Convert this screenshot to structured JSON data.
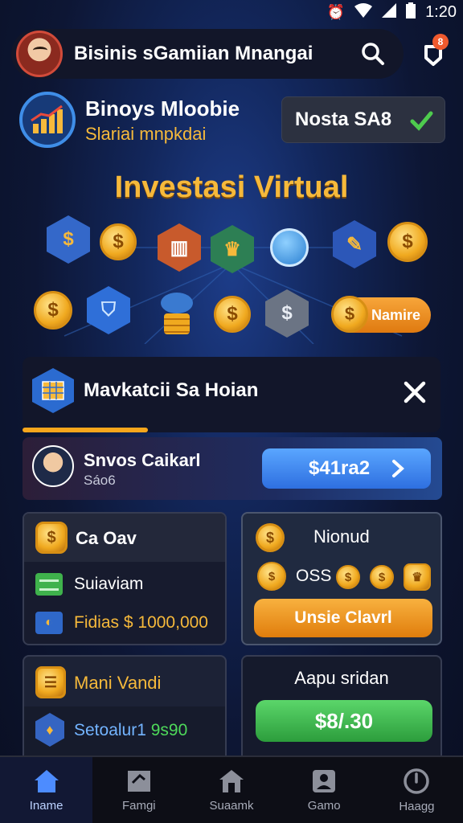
{
  "status_bar": {
    "time": "1:20"
  },
  "header": {
    "title": "Bisinis sGamiian Mnangai",
    "notification_badge": "8"
  },
  "brand": {
    "name": "Binoys Mloobie",
    "subtitle": "Slariai mnpkdai",
    "status_pill": "Nosta SA8"
  },
  "hero": {
    "title": "Investasi Virtual",
    "name_pill": "Namire"
  },
  "section": {
    "title": "Mavkatcii Sa Hoian"
  },
  "user_card": {
    "name": "Snvos Caikarl",
    "sub": "Sáo6",
    "amount": "$41ra2"
  },
  "card_a": {
    "title": "Ca Oav",
    "row1": "Suiaviam",
    "row2_label": "Fidias",
    "row2_value": "$ 1000,000"
  },
  "card_b": {
    "title": "Nionud",
    "row": "OSS",
    "button": "Unsie Clavrl"
  },
  "card_c": {
    "title": "Mani Vandi",
    "row_label": "Setoalur1",
    "row_value": "9s90"
  },
  "card_d": {
    "title": "Aapu sridan",
    "button": "$8/.30"
  },
  "nav": [
    {
      "label": "Iname",
      "icon": "home-icon"
    },
    {
      "label": "Famgi",
      "icon": "chat-icon"
    },
    {
      "label": "Suaamk",
      "icon": "store-icon"
    },
    {
      "label": "Gamo",
      "icon": "profile-icon"
    },
    {
      "label": "Haagg",
      "icon": "power-icon"
    }
  ],
  "colors": {
    "accent": "#f6b93b",
    "blue": "#2e6fe0",
    "green": "#2c9d3c",
    "orange": "#e07d0c",
    "background": "#0e1330"
  }
}
